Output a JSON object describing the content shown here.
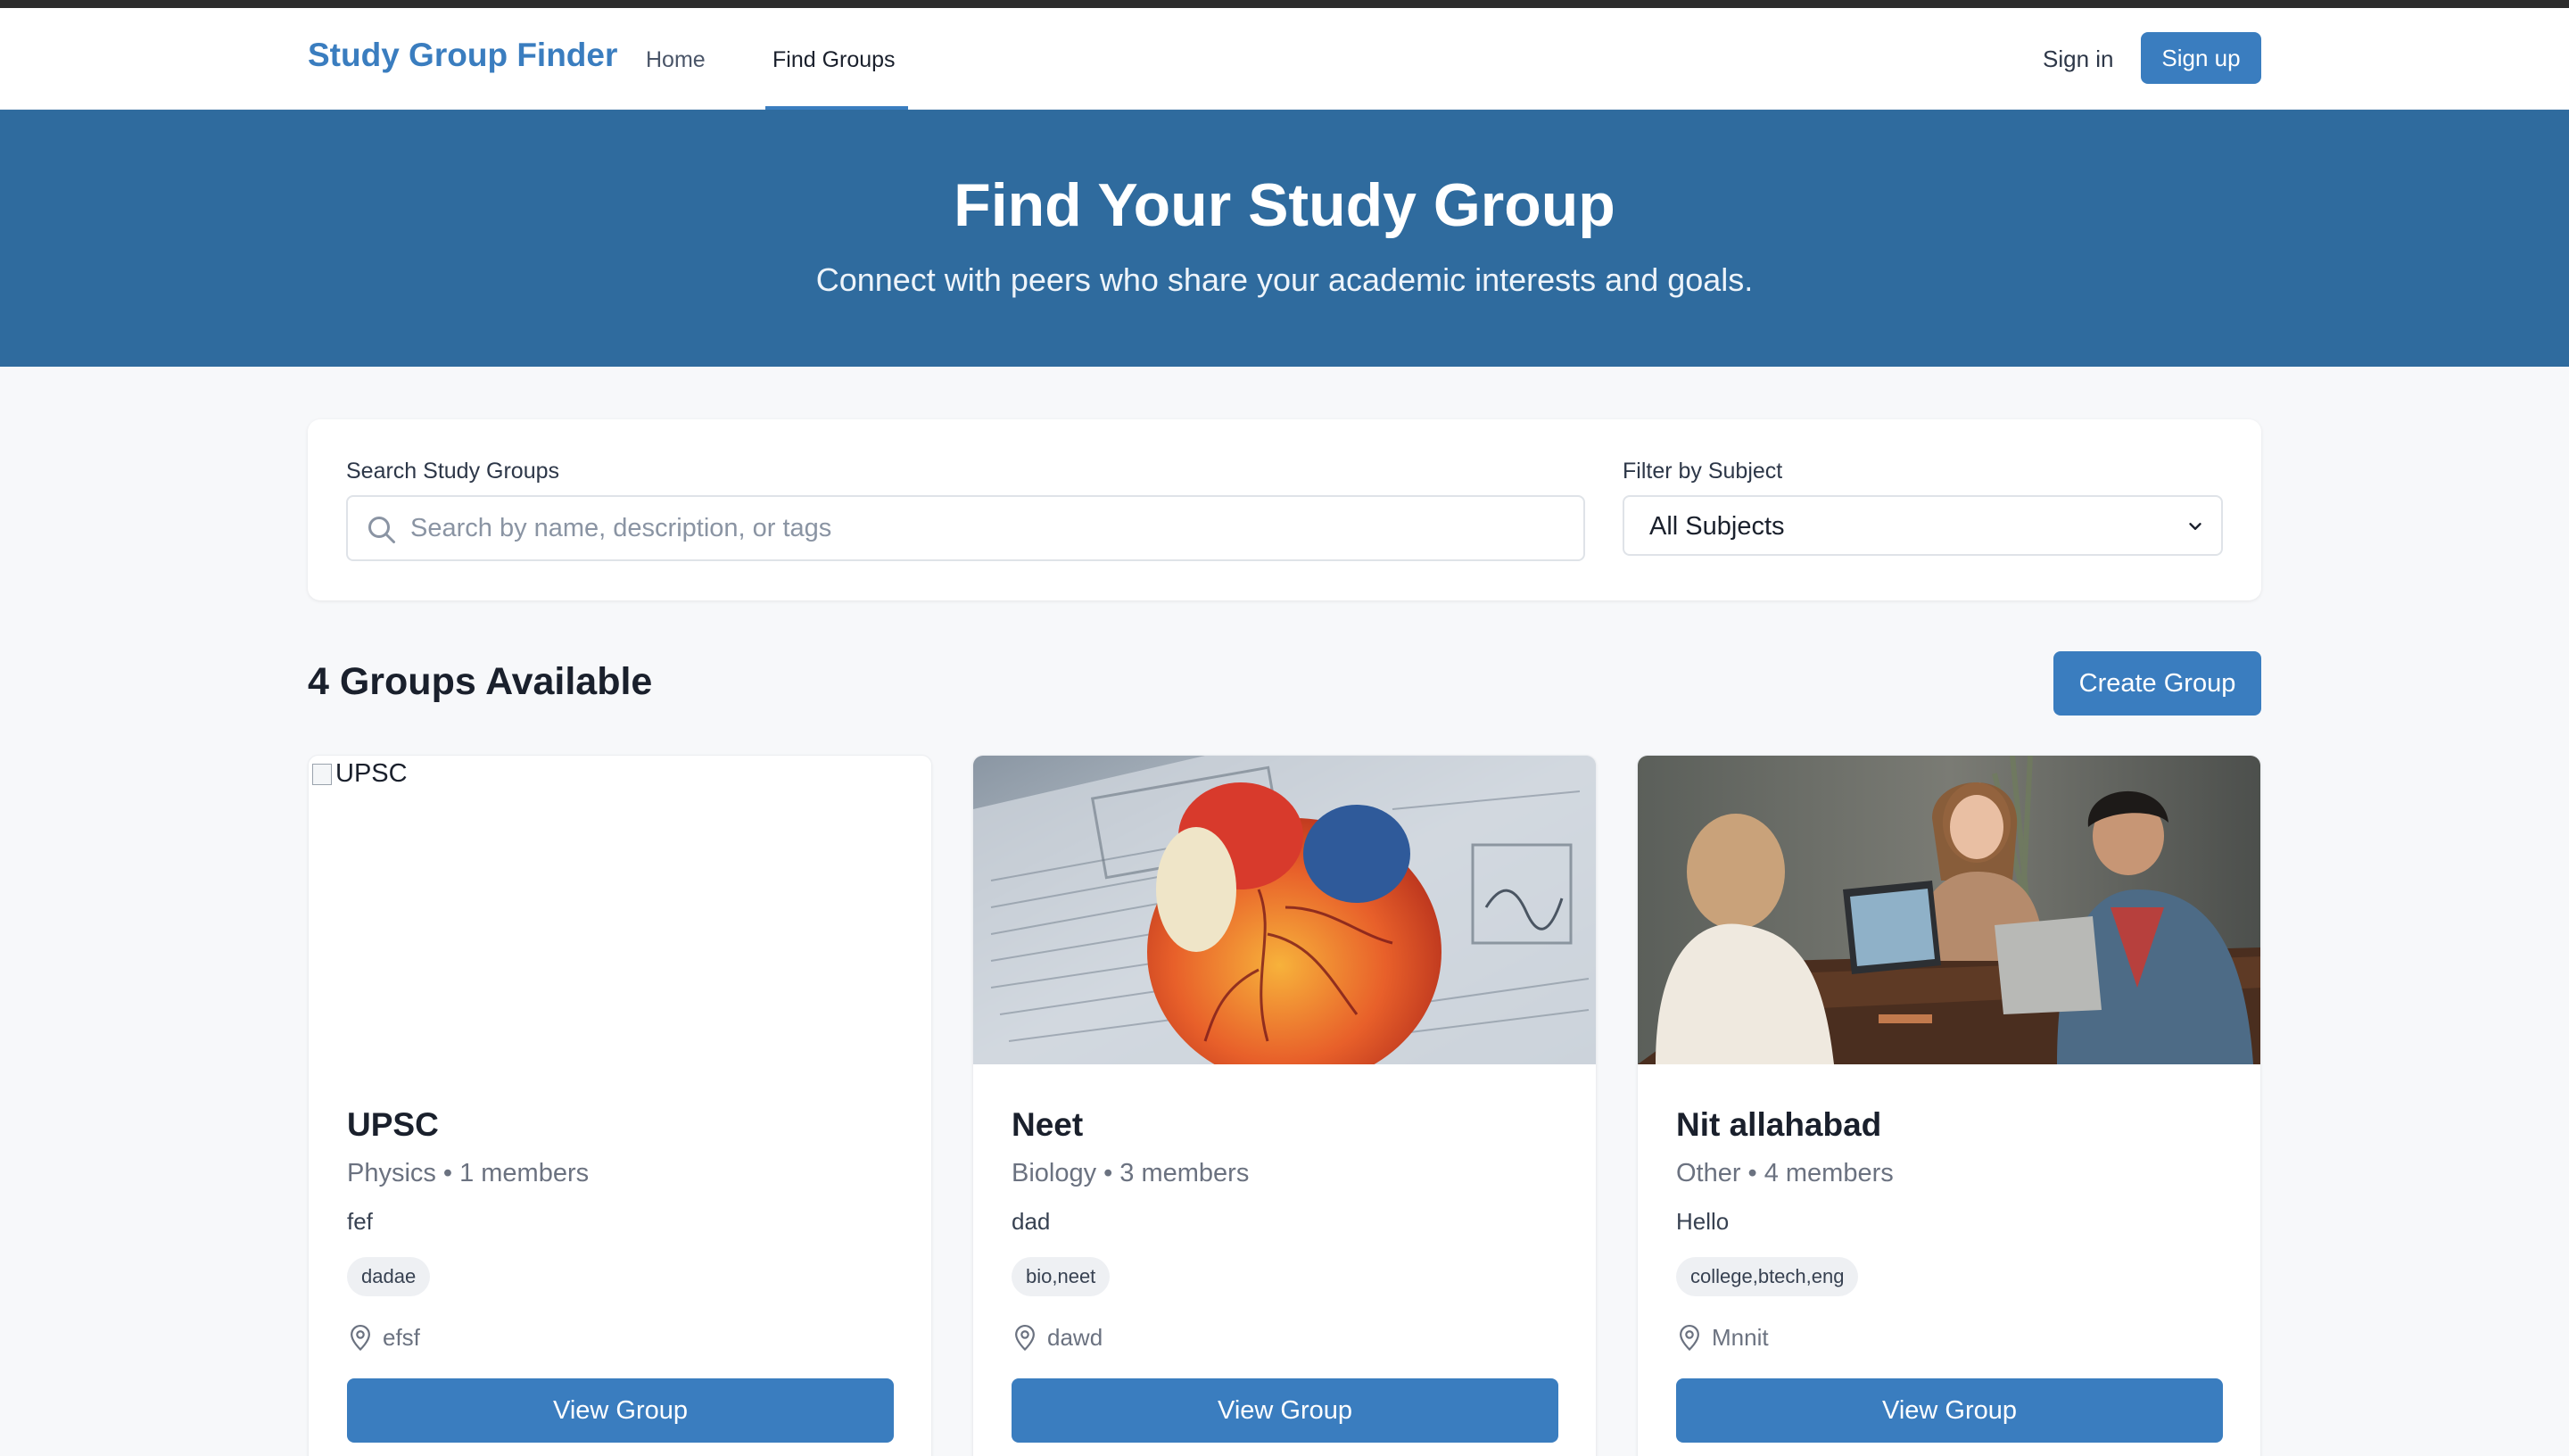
{
  "nav": {
    "brand": "Study Group Finder",
    "home": "Home",
    "find_groups": "Find Groups",
    "sign_in": "Sign in",
    "sign_up": "Sign up"
  },
  "hero": {
    "title": "Find Your Study Group",
    "subtitle": "Connect with peers who share your academic interests and goals."
  },
  "filters": {
    "search_label": "Search Study Groups",
    "search_placeholder": "Search by name, description, or tags",
    "search_value": "",
    "subject_label": "Filter by Subject",
    "subject_value": "All Subjects"
  },
  "results": {
    "count_text": "4 Groups Available",
    "create_label": "Create Group"
  },
  "groups": [
    {
      "image_alt": "UPSC",
      "image_broken": true,
      "title": "UPSC",
      "subject": "Physics",
      "members": "1 members",
      "description": "fef",
      "tags": "dadae",
      "location": "efsf",
      "button": "View Group"
    },
    {
      "image_alt": "Neet",
      "image_broken": false,
      "title": "Neet",
      "subject": "Biology",
      "members": "3 members",
      "description": "dad",
      "tags": "bio,neet",
      "location": "dawd",
      "button": "View Group"
    },
    {
      "image_alt": "Nit allahabad",
      "image_broken": false,
      "title": "Nit allahabad",
      "subject": "Other",
      "members": "4 members",
      "description": "Hello",
      "tags": "college,btech,eng",
      "location": "Mnnit",
      "button": "View Group"
    }
  ],
  "colors": {
    "brand": "#3a7dbf",
    "hero_bg": "#2f6b9e",
    "page_bg": "#f7f8fa"
  }
}
